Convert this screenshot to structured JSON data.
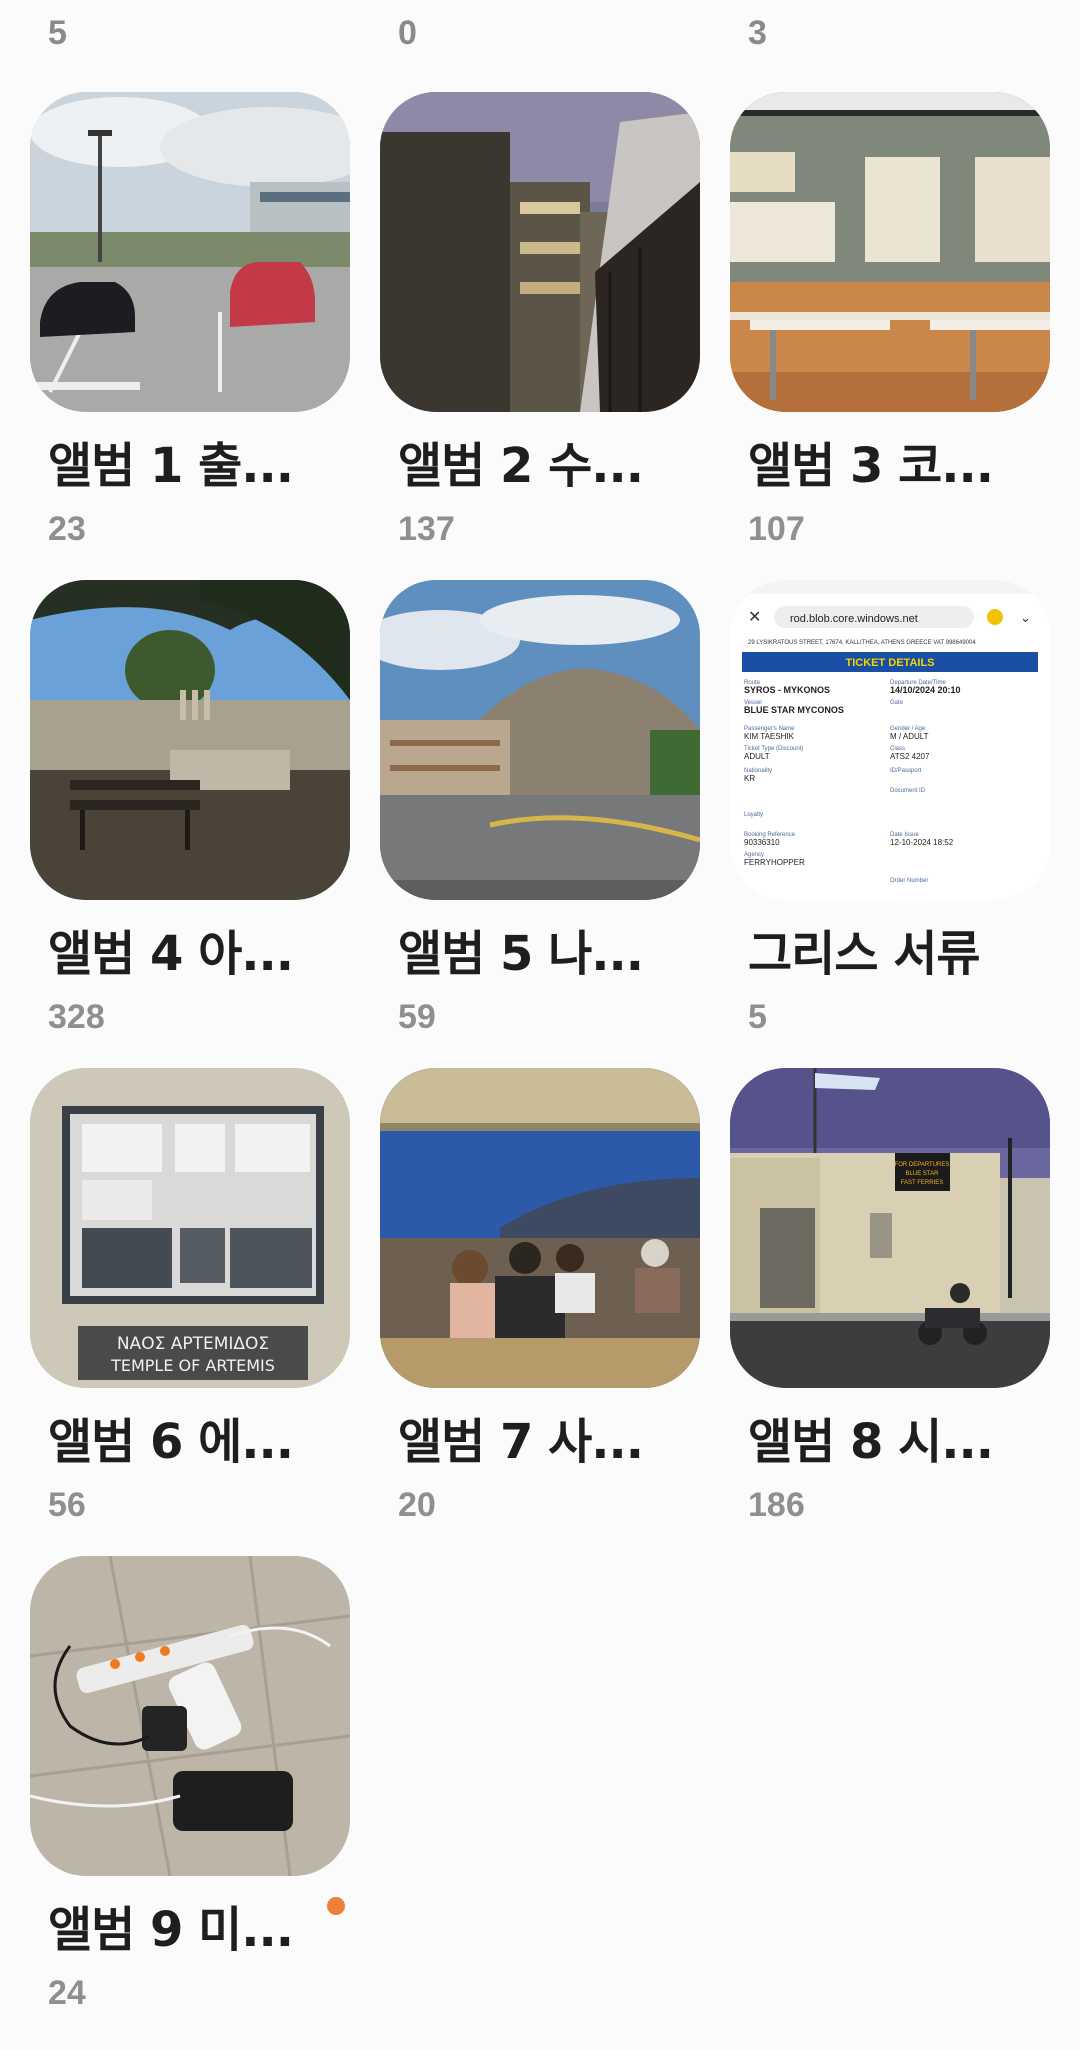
{
  "top_counts": [
    "5",
    "0",
    "3"
  ],
  "albums": [
    {
      "title": "앨범 1 출...",
      "count": "23",
      "thumb": "parking-lot-photo"
    },
    {
      "title": "앨범 2 수...",
      "count": "137",
      "thumb": "street-buildings-photo"
    },
    {
      "title": "앨범 3 코...",
      "count": "107",
      "thumb": "museum-room-photo"
    },
    {
      "title": "앨범 4 아...",
      "count": "328",
      "thumb": "ruins-photo"
    },
    {
      "title": "앨범 5 나...",
      "count": "59",
      "thumb": "hill-town-photo"
    },
    {
      "title": "그리스 서류",
      "count": "5",
      "thumb": "ticket-screenshot"
    },
    {
      "title": "앨범 6 에...",
      "count": "56",
      "thumb": "temple-poster-photo"
    },
    {
      "title": "앨범 7 사...",
      "count": "20",
      "thumb": "dinner-terrace-photo"
    },
    {
      "title": "앨범 8 시...",
      "count": "186",
      "thumb": "port-building-photo"
    },
    {
      "title": "앨범 9 미...",
      "count": "24",
      "thumb": "chargers-photo",
      "new": true
    }
  ],
  "ticket": {
    "url": "rod.blob.core.windows.net",
    "address_line": "29 LYSIKRATOUS STREET, 17674, KALLITHEA, ATHENS GREECE VAT 998649004",
    "heading": "TICKET DETAILS",
    "route_label": "Route",
    "route": "SYROS - MYKONOS",
    "departure_label": "Departure Date/Time",
    "departure": "14/10/2024 20:10",
    "vessel_label": "Vessel",
    "vessel": "BLUE STAR MYCONOS",
    "gate_label": "Gate",
    "passenger_label": "Passenger's Name",
    "passenger": "KIM TAESHIK",
    "gender_label": "Gender / Age",
    "gender": "M / ADULT",
    "type_label": "Ticket Type (Discount)",
    "type": "ADULT",
    "class_label": "Class",
    "class": "ATS2 4207",
    "nationality_label": "Nationality",
    "nationality": "KR",
    "id_label": "ID/Passport",
    "document_label": "Document ID",
    "loyalty_label": "Loyalty",
    "booking_label": "Booking Reference",
    "booking": "90336310",
    "issue_label": "Date Issue",
    "issue": "12-10-2024 18:52",
    "agency_label": "Agency",
    "agency": "FERRYHOPPER",
    "order_label": "Order Number"
  },
  "poster": {
    "greek": "ΝΑΟΣ ΑΡΤΕΜΙΔΟΣ",
    "english": "TEMPLE OF ARTEMIS"
  },
  "port_sign": {
    "line1": "FOR DEPARTURES",
    "line2": "BLUE STAR",
    "line3": "FAST FERRIES"
  },
  "colors": {
    "accent_dot": "#f07f3c",
    "title": "#1e1e1e",
    "count": "#8f8f8f"
  }
}
